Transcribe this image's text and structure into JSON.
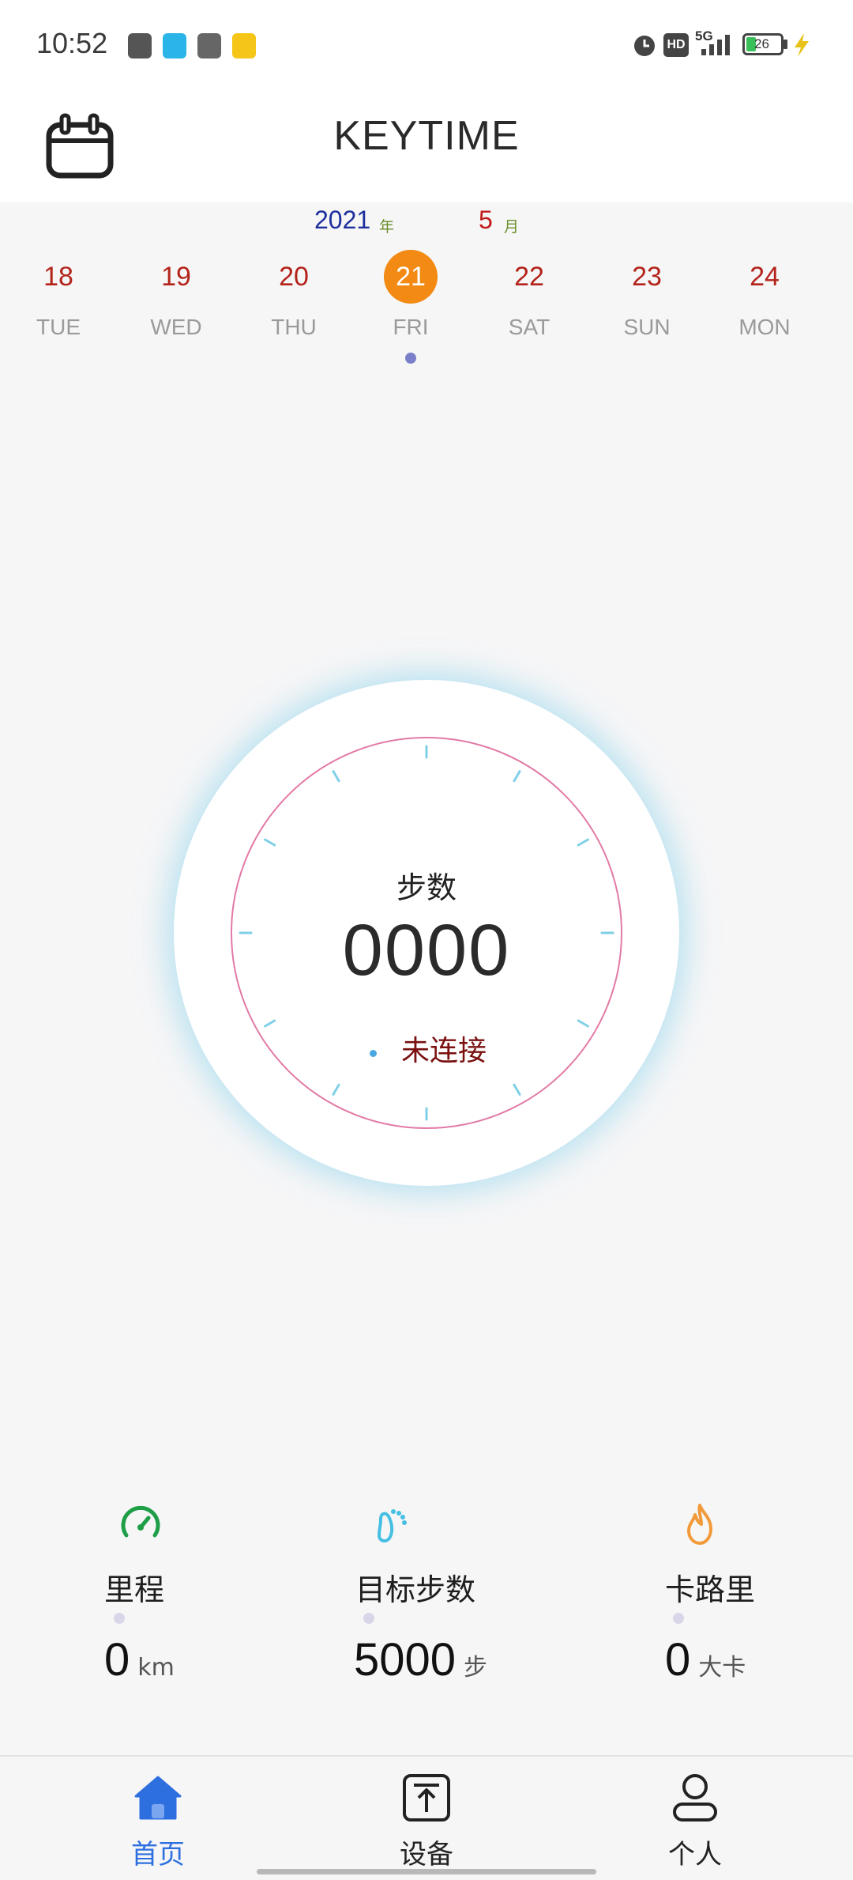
{
  "status_bar": {
    "time": "10:52",
    "battery": "26",
    "network": "5G",
    "hd_label": "HD"
  },
  "header": {
    "title": "KEYTIME",
    "calendar_icon": "calendar-icon"
  },
  "date_strip": {
    "year": "2021",
    "year_unit": "年",
    "month": "5",
    "month_unit": "月",
    "days": [
      {
        "num": "18",
        "weekday": "TUE"
      },
      {
        "num": "19",
        "weekday": "WED"
      },
      {
        "num": "20",
        "weekday": "THU"
      },
      {
        "num": "21",
        "weekday": "FRI",
        "selected": true
      },
      {
        "num": "22",
        "weekday": "SAT"
      },
      {
        "num": "23",
        "weekday": "SUN"
      },
      {
        "num": "24",
        "weekday": "MON"
      }
    ],
    "selected_color": "#f28a13",
    "day_color": "#b3231a"
  },
  "gauge": {
    "label": "步数",
    "value": "0000",
    "status": "未连接",
    "ring_color": "#e27aa6",
    "tick_color": "#7fd0e6"
  },
  "stats": [
    {
      "icon": "speedometer-icon",
      "label": "里程",
      "value": "0",
      "unit": "km",
      "icon_color": "#1e9e47"
    },
    {
      "icon": "footprint-icon",
      "label": "目标步数",
      "value": "5000",
      "unit": "步",
      "icon_color": "#46bfe3"
    },
    {
      "icon": "flame-icon",
      "label": "卡路里",
      "value": "0",
      "unit": "大卡",
      "icon_color": "#f29a3a"
    }
  ],
  "bottom_nav": {
    "items": [
      {
        "icon": "home-icon",
        "label": "首页",
        "active": true
      },
      {
        "icon": "upload-box-icon",
        "label": "设备"
      },
      {
        "icon": "person-icon",
        "label": "个人"
      }
    ],
    "active_color": "#2e6fe0"
  }
}
